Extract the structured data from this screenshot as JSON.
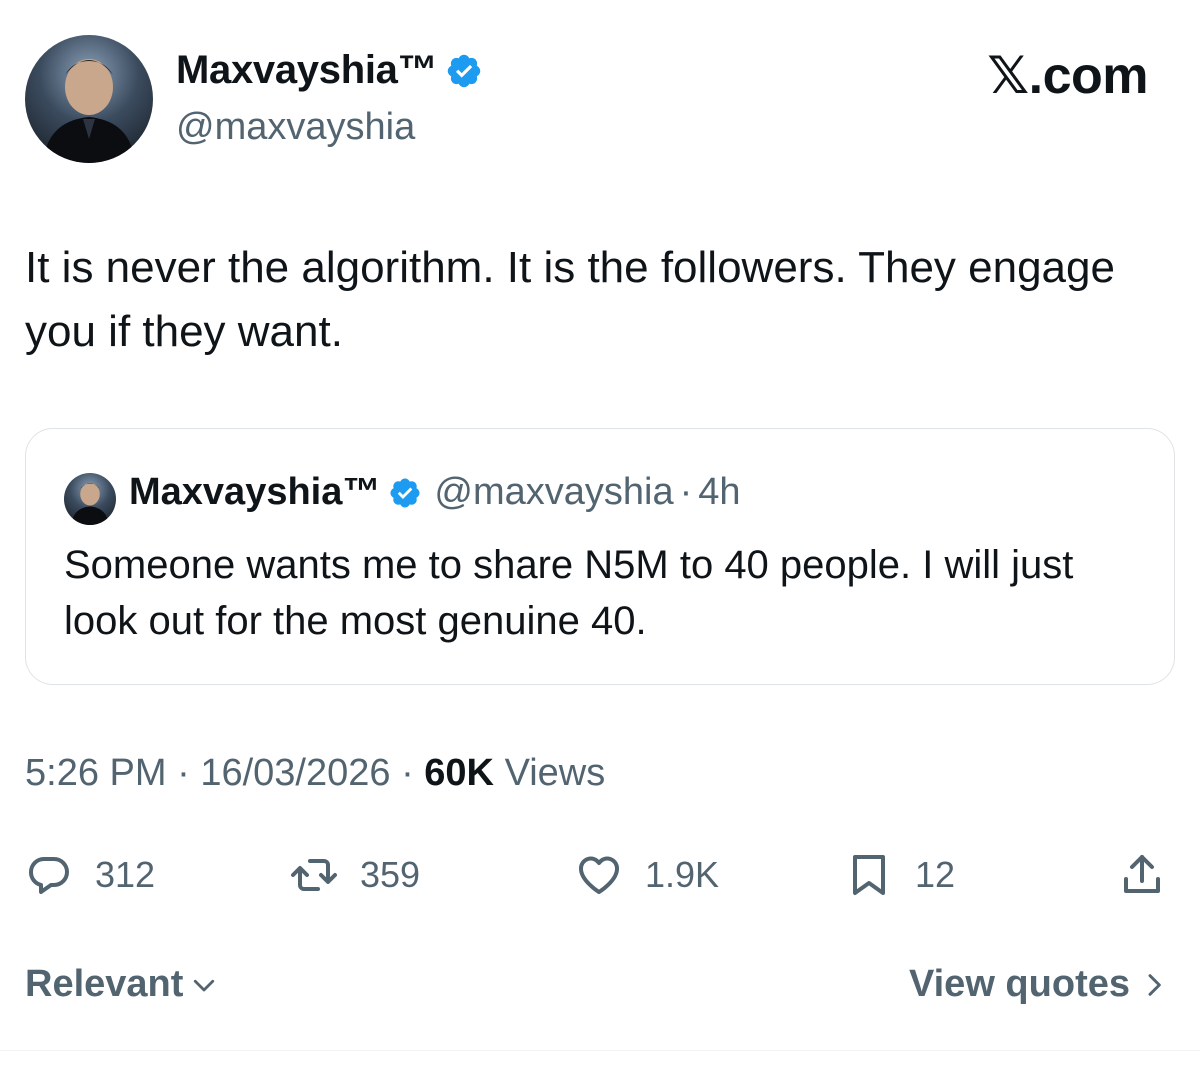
{
  "author": {
    "display_name": "Maxvayshia™",
    "handle": "@maxvayshia",
    "verified": true,
    "avatar_icon": "profile-photo"
  },
  "brand": "𝕏.com",
  "tweet": {
    "text": "It is never the algorithm. It is the followers. They engage you if they want."
  },
  "quoted_tweet": {
    "display_name": "Maxvayshia™",
    "handle": "@maxvayshia",
    "separator": "·",
    "time": "4h",
    "text": "Someone wants me to share N5M to 40 people. I will just look out for the most genuine 40."
  },
  "meta": {
    "time": "5:26 PM",
    "separator": "·",
    "date": "16/03/2026",
    "views_count": "60K",
    "views_label": "Views"
  },
  "actions": {
    "replies": "312",
    "reposts": "359",
    "likes": "1.9K",
    "bookmarks": "12"
  },
  "footer": {
    "sort_label": "Relevant",
    "view_quotes_label": "View quotes"
  },
  "colors": {
    "verified_blue": "#1d9bf0",
    "secondary_text": "#536471",
    "primary_text": "#0f1419"
  }
}
